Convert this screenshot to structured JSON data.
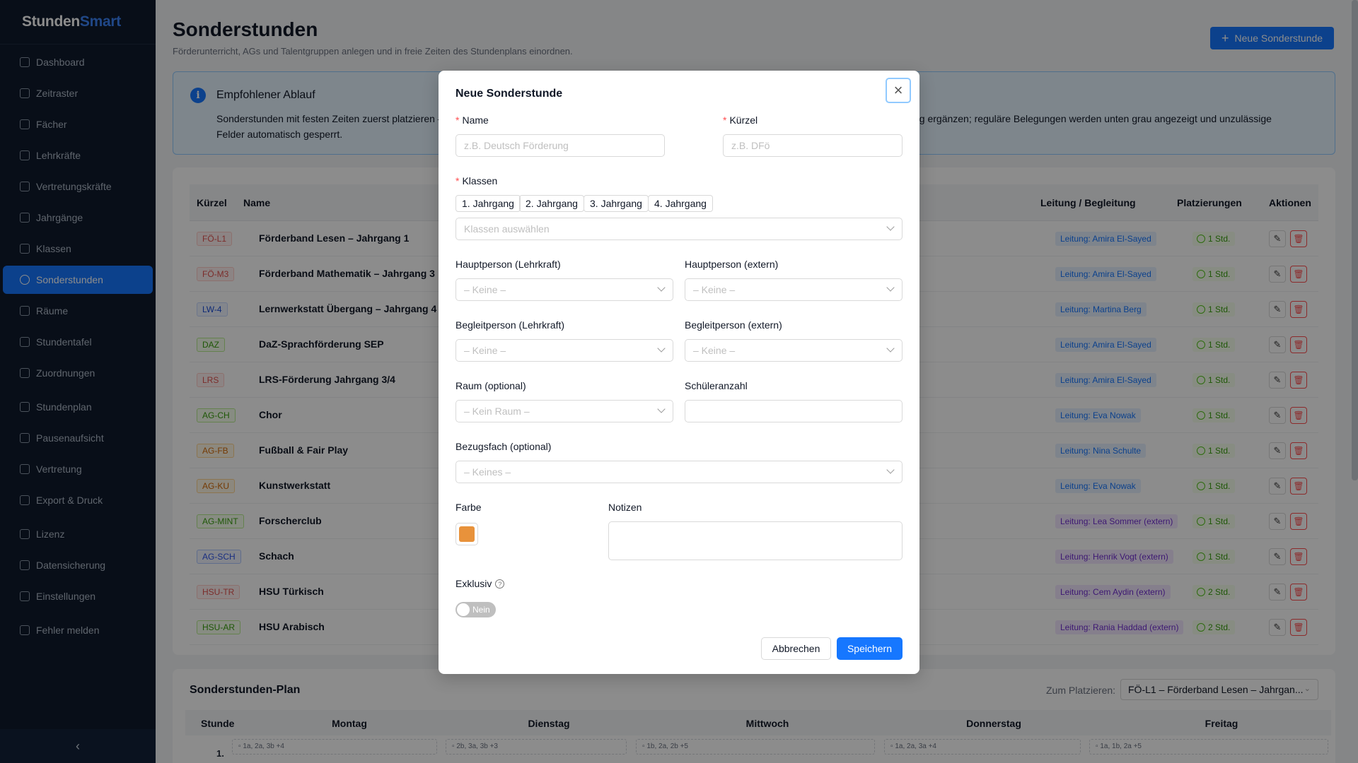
{
  "app": {
    "logo_main": "Stunden",
    "logo_accent": "Smart"
  },
  "sidebar": {
    "items": [
      {
        "label": "Dashboard",
        "icon": "home-icon"
      },
      {
        "label": "Zeitraster",
        "icon": "calendar-icon"
      },
      {
        "label": "Fächer",
        "icon": "book-icon"
      },
      {
        "label": "Lehrkräfte",
        "icon": "user-icon"
      },
      {
        "label": "Vertretungskräfte",
        "icon": "users-icon"
      },
      {
        "label": "Jahrgänge",
        "icon": "list-icon"
      },
      {
        "label": "Klassen",
        "icon": "group-icon"
      },
      {
        "label": "Sonderstunden",
        "icon": "star-icon"
      },
      {
        "label": "Räume",
        "icon": "building-icon"
      },
      {
        "label": "Stundentafel",
        "icon": "table-icon"
      },
      {
        "label": "Zuordnungen",
        "icon": "link-icon"
      },
      {
        "label": "Stundenplan",
        "icon": "schedule-icon"
      },
      {
        "label": "Pausenaufsicht",
        "icon": "coffee-icon"
      },
      {
        "label": "Vertretung",
        "icon": "swap-icon"
      },
      {
        "label": "Export & Druck",
        "icon": "printer-icon"
      },
      {
        "label": "Lizenz",
        "icon": "shield-icon"
      },
      {
        "label": "Datensicherung",
        "icon": "database-icon"
      },
      {
        "label": "Einstellungen",
        "icon": "gear-icon"
      },
      {
        "label": "Fehler melden",
        "icon": "mail-icon"
      }
    ],
    "active": "Sonderstunden",
    "collapse_icon": "‹"
  },
  "page": {
    "title": "Sonderstunden",
    "subtitle": "Förderunterricht, AGs und Talentgruppen anlegen und in freie Zeiten des Stundenplans einordnen.",
    "new_button": "Neue Sonderstunde"
  },
  "info": {
    "title": "Empfohlener Ablauf",
    "text_left": "Sonderstunden mit festen Zeiten zuerst platzieren –",
    "text_right": "chnung ergänzen; reguläre Belegungen werden unten grau angezeigt und unzulässige",
    "text_line2": "Felder automatisch gesperrt."
  },
  "table": {
    "headers": {
      "kuerzel": "Kürzel",
      "name": "Name",
      "leitung": "Leitung / Begleitung",
      "platz": "Platzierungen",
      "aktionen": "Aktionen"
    },
    "rows": [
      {
        "kuerzel": "FÖ-L1",
        "color": "red",
        "name": "Förderband Lesen – Jahrgang 1",
        "leitung": "Leitung: Amira El-Sayed",
        "ext": false,
        "platz": "1 Std."
      },
      {
        "kuerzel": "FÖ-M3",
        "color": "red",
        "name": "Förderband Mathematik – Jahrgang 3",
        "leitung": "Leitung: Amira El-Sayed",
        "ext": false,
        "platz": "1 Std."
      },
      {
        "kuerzel": "LW-4",
        "color": "blue",
        "name": "Lernwerkstatt Übergang – Jahrgang 4",
        "leitung": "Leitung: Martina Berg",
        "ext": false,
        "platz": "1 Std."
      },
      {
        "kuerzel": "DAZ",
        "color": "green",
        "name": "DaZ-Sprachförderung SEP",
        "leitung": "Leitung: Amira El-Sayed",
        "ext": false,
        "platz": "1 Std."
      },
      {
        "kuerzel": "LRS",
        "color": "red",
        "name": "LRS-Förderung Jahrgang 3/4",
        "leitung": "Leitung: Amira El-Sayed",
        "ext": false,
        "platz": "1 Std."
      },
      {
        "kuerzel": "AG-CH",
        "color": "green",
        "name": "Chor",
        "leitung": "Leitung: Eva Nowak",
        "ext": false,
        "platz": "1 Std."
      },
      {
        "kuerzel": "AG-FB",
        "color": "orange",
        "name": "Fußball & Fair Play",
        "leitung": "Leitung: Nina Schulte",
        "ext": false,
        "platz": "1 Std."
      },
      {
        "kuerzel": "AG-KU",
        "color": "orange",
        "name": "Kunstwerkstatt",
        "leitung": "Leitung: Eva Nowak",
        "ext": false,
        "platz": "1 Std."
      },
      {
        "kuerzel": "AG-MINT",
        "color": "green",
        "name": "Forscherclub",
        "leitung": "Leitung: Lea Sommer (extern)",
        "ext": true,
        "platz": "1 Std."
      },
      {
        "kuerzel": "AG-SCH",
        "color": "indigo",
        "name": "Schach",
        "leitung": "Leitung: Henrik Vogt (extern)",
        "ext": true,
        "platz": "1 Std."
      },
      {
        "kuerzel": "HSU-TR",
        "color": "red",
        "name": "HSU Türkisch",
        "leitung": "Leitung: Cem Aydin (extern)",
        "ext": true,
        "platz": "2 Std."
      },
      {
        "kuerzel": "HSU-AR",
        "color": "green",
        "name": "HSU Arabisch",
        "leitung": "Leitung: Rania Haddad (extern)",
        "ext": true,
        "platz": "2 Std."
      }
    ]
  },
  "plan": {
    "title": "Sonderstunden-Plan",
    "place_label": "Zum Platzieren:",
    "place_value": "FÖ-L1 – Förderband Lesen – Jahrgan...",
    "headers": [
      "Stunde",
      "Montag",
      "Dienstag",
      "Mittwoch",
      "Donnerstag",
      "Freitag"
    ],
    "row1": "1.",
    "slots": [
      "1a, 2a, 3b +4",
      "2b, 3a, 3b +3",
      "1b, 2a, 2b +5",
      "1a, 2a, 3a +4",
      "1a, 1b, 2a +5"
    ]
  },
  "modal": {
    "title": "Neue Sonderstunde",
    "name_label": "Name",
    "name_placeholder": "z.B. Deutsch Förderung",
    "kuerzel_label": "Kürzel",
    "kuerzel_placeholder": "z.B. DFö",
    "klassen_label": "Klassen",
    "chips": [
      "1. Jahrgang",
      "2. Jahrgang",
      "3. Jahrgang",
      "4. Jahrgang"
    ],
    "klassen_placeholder": "Klassen auswählen",
    "haupt_lehr_label": "Hauptperson (Lehrkraft)",
    "haupt_lehr_value": "– Keine –",
    "haupt_ext_label": "Hauptperson (extern)",
    "haupt_ext_value": "– Keine –",
    "begl_lehr_label": "Begleitperson (Lehrkraft)",
    "begl_lehr_value": "– Keine –",
    "begl_ext_label": "Begleitperson (extern)",
    "begl_ext_value": "– Keine –",
    "raum_label": "Raum (optional)",
    "raum_value": "– Kein Raum –",
    "schueler_label": "Schüleranzahl",
    "bezug_label": "Bezugsfach (optional)",
    "bezug_value": "– Keines –",
    "farbe_label": "Farbe",
    "farbe_value": "#e8923b",
    "notizen_label": "Notizen",
    "exklusiv_label": "Exklusiv",
    "toggle_label": "Nein",
    "cancel": "Abbrechen",
    "save": "Speichern"
  }
}
